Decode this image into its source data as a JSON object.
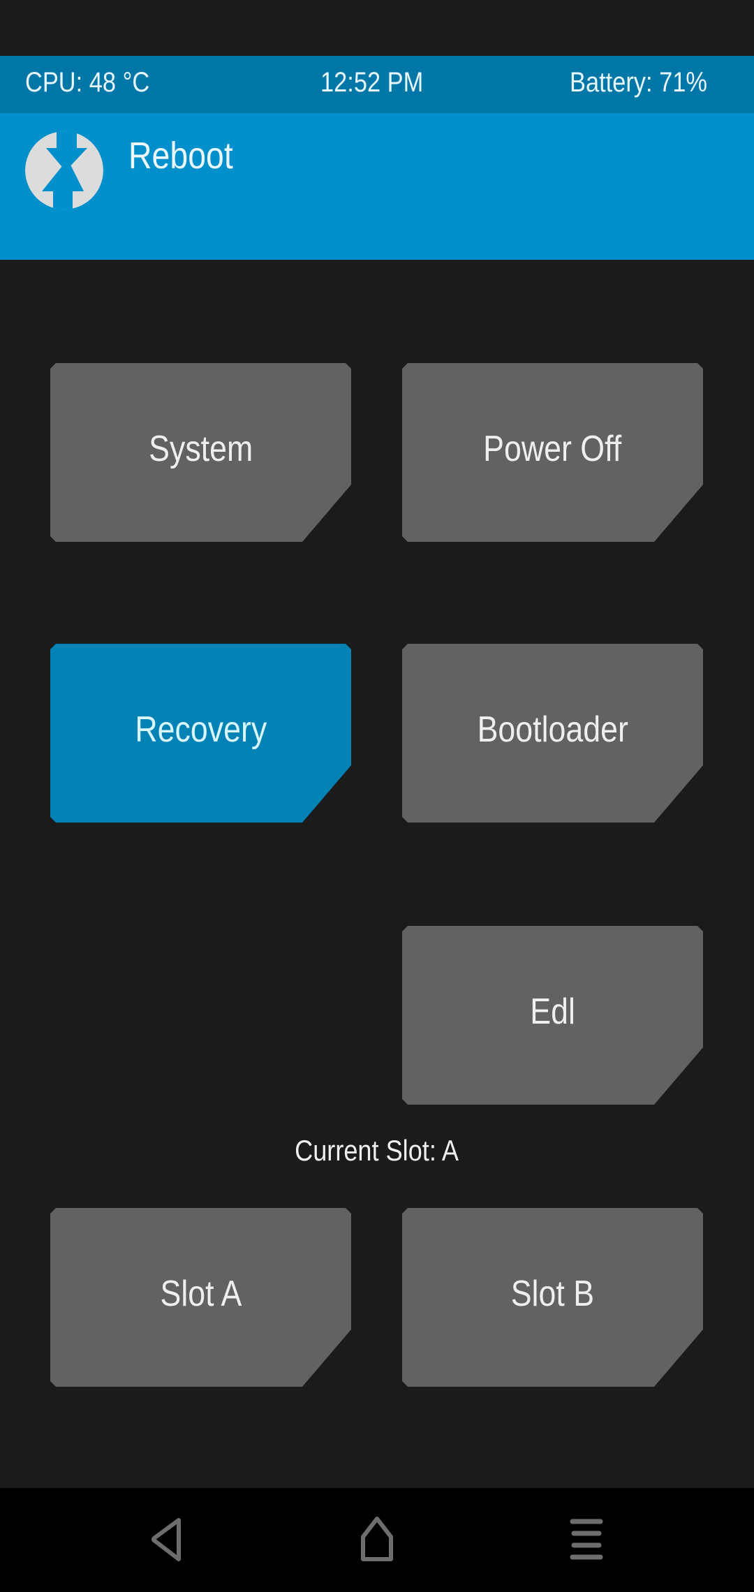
{
  "status_bar": {
    "cpu": "CPU: 48 °C",
    "time": "12:52 PM",
    "battery": "Battery: 71%"
  },
  "header": {
    "title": "Reboot",
    "logo_icon": "twrp-logo-icon"
  },
  "buttons": {
    "system": "System",
    "power_off": "Power Off",
    "recovery": "Recovery",
    "bootloader": "Bootloader",
    "edl": "Edl",
    "slot_a": "Slot A",
    "slot_b": "Slot B"
  },
  "current_slot": "Current Slot: A",
  "nav": {
    "back_icon": "back-icon",
    "home_icon": "home-icon",
    "menu_icon": "menu-icon"
  },
  "colors": {
    "status_bar": "#0177a8",
    "header": "#0190cb",
    "button": "#626262",
    "button_active": "#0282b5",
    "background": "#1b1b1b"
  }
}
